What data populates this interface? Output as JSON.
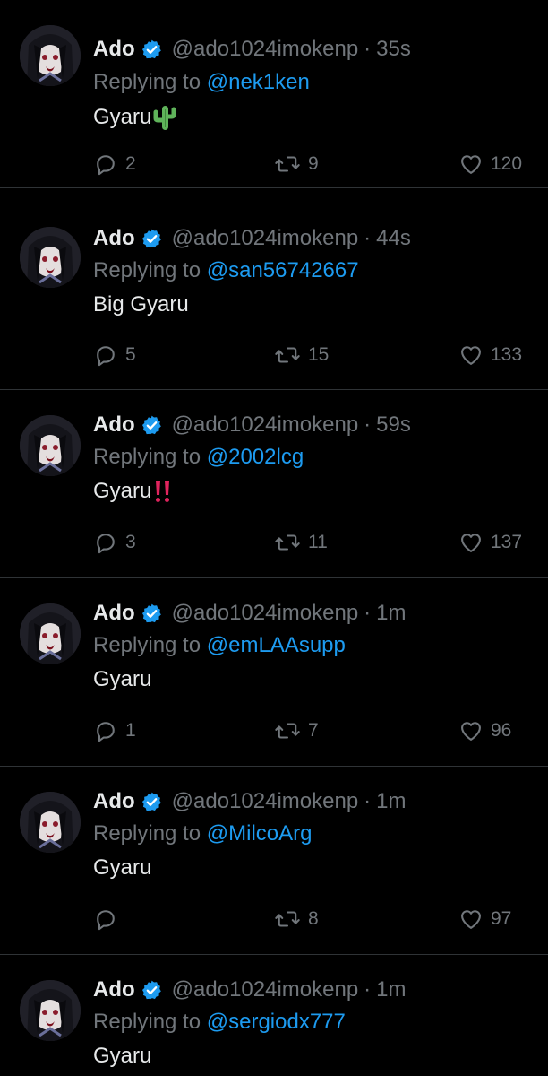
{
  "colors": {
    "background": "#000000",
    "text": "#e7e9ea",
    "muted": "#71767b",
    "accent": "#1d9bf0",
    "divider": "#2f3336"
  },
  "icons": {
    "verified": "verified-badge-icon",
    "reply": "reply-bubble-icon",
    "retweet": "retweet-icon",
    "like": "heart-icon"
  },
  "tweets": [
    {
      "name": "Ado",
      "handle": "@ado1024imokenp",
      "dot": "·",
      "time": "35s",
      "replying_prefix": "Replying to",
      "replying_to": "@nek1ken",
      "text": "Gyaru",
      "emoji": "cactus",
      "replies": "2",
      "retweets": "9",
      "likes": "120"
    },
    {
      "name": "Ado",
      "handle": "@ado1024imokenp",
      "dot": "·",
      "time": "44s",
      "replying_prefix": "Replying to",
      "replying_to": "@san56742667",
      "text": "Big Gyaru",
      "emoji": "",
      "replies": "5",
      "retweets": "15",
      "likes": "133"
    },
    {
      "name": "Ado",
      "handle": "@ado1024imokenp",
      "dot": "·",
      "time": "59s",
      "replying_prefix": "Replying to",
      "replying_to": "@2002lcg",
      "text": "Gyaru",
      "emoji": "double-exclamation",
      "replies": "3",
      "retweets": "11",
      "likes": "137"
    },
    {
      "name": "Ado",
      "handle": "@ado1024imokenp",
      "dot": "·",
      "time": "1m",
      "replying_prefix": "Replying to",
      "replying_to": "@emLAAsupp",
      "text": "Gyaru",
      "emoji": "",
      "replies": "1",
      "retweets": "7",
      "likes": "96"
    },
    {
      "name": "Ado",
      "handle": "@ado1024imokenp",
      "dot": "·",
      "time": "1m",
      "replying_prefix": "Replying to",
      "replying_to": "@MilcoArg",
      "text": "Gyaru",
      "emoji": "",
      "replies": "",
      "retweets": "8",
      "likes": "97"
    },
    {
      "name": "Ado",
      "handle": "@ado1024imokenp",
      "dot": "·",
      "time": "1m",
      "replying_prefix": "Replying to",
      "replying_to": "@sergiodx777",
      "text": "Gyaru",
      "emoji": "",
      "replies": "",
      "retweets": "",
      "likes": ""
    }
  ]
}
